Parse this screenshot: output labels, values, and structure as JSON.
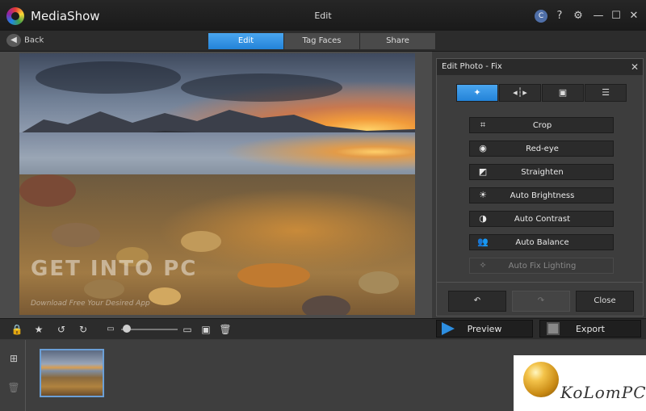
{
  "app": {
    "name": "MediaShow",
    "window_title": "Edit"
  },
  "titlebar_icons": [
    "cyberlink-icon",
    "help-icon",
    "gear-icon",
    "minimize-icon",
    "maximize-icon",
    "close-icon"
  ],
  "nav": {
    "back_label": "Back",
    "tabs": [
      {
        "label": "Edit",
        "active": true
      },
      {
        "label": "Tag Faces",
        "active": false
      },
      {
        "label": "Share",
        "active": false
      }
    ]
  },
  "photo": {
    "watermark_main": "GET INTO PC",
    "watermark_sub": "Download Free Your Desired App"
  },
  "panel": {
    "title": "Edit Photo - Fix",
    "mode_tabs": [
      {
        "icon": "magic-wand-icon",
        "active": true
      },
      {
        "icon": "adjust-icon",
        "active": false
      },
      {
        "icon": "effects-icon",
        "active": false
      },
      {
        "icon": "checklist-icon",
        "active": false
      }
    ],
    "fix_buttons": [
      {
        "label": "Crop",
        "icon": "crop-icon",
        "enabled": true
      },
      {
        "label": "Red-eye",
        "icon": "eye-icon",
        "enabled": true
      },
      {
        "label": "Straighten",
        "icon": "straighten-icon",
        "enabled": true
      },
      {
        "label": "Auto Brightness",
        "icon": "sun-icon",
        "enabled": true
      },
      {
        "label": "Auto Contrast",
        "icon": "contrast-icon",
        "enabled": true
      },
      {
        "label": "Auto Balance",
        "icon": "balance-icon",
        "enabled": true
      },
      {
        "label": "Auto Fix Lighting",
        "icon": "fix-lighting-icon",
        "enabled": false
      }
    ],
    "undo_icon": "undo-icon",
    "redo_icon": "redo-icon",
    "close_label": "Close"
  },
  "toolbar": {
    "icons": [
      "lock-icon",
      "star-icon",
      "rotate-left-icon",
      "rotate-right-icon",
      "zoom-out-icon",
      "zoom-in-icon",
      "face-icon",
      "trash-icon"
    ],
    "zoom_level": 0.05,
    "preview_label": "Preview",
    "export_label": "Export"
  },
  "filmstrip": {
    "side_icons": [
      "add-photo-icon",
      "trash-icon"
    ]
  },
  "overlay_logo": {
    "text": "KoLomPC"
  },
  "colors": {
    "accent": "#2e8ee0",
    "bg": "#3a3a3a"
  }
}
